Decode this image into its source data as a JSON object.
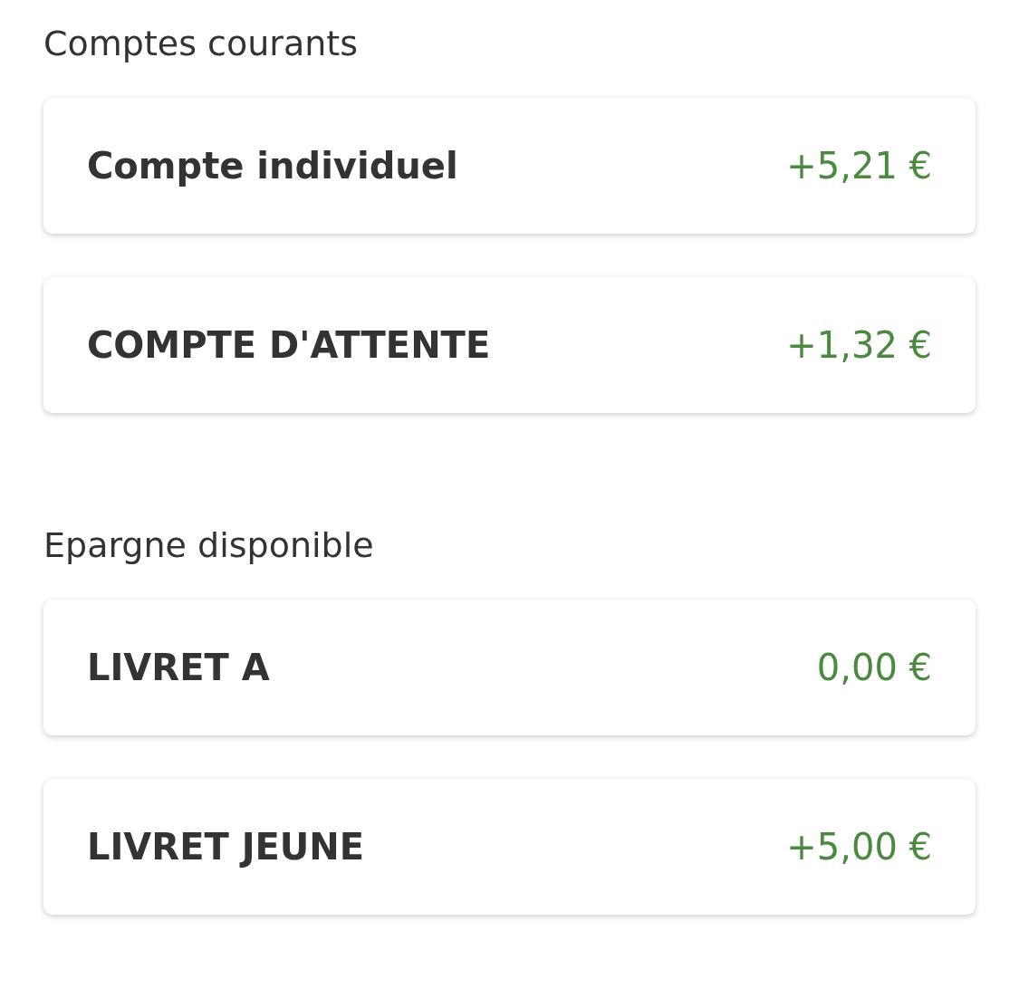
{
  "sections": [
    {
      "title": "Comptes courants",
      "accounts": [
        {
          "name": "Compte individuel",
          "amount": "+5,21 €"
        },
        {
          "name": "COMPTE D'ATTENTE",
          "amount": "+1,32 €"
        }
      ]
    },
    {
      "title": "Epargne disponible",
      "accounts": [
        {
          "name": "LIVRET A",
          "amount": "0,00 €"
        },
        {
          "name": "LIVRET JEUNE",
          "amount": "+5,00 €"
        }
      ]
    }
  ]
}
